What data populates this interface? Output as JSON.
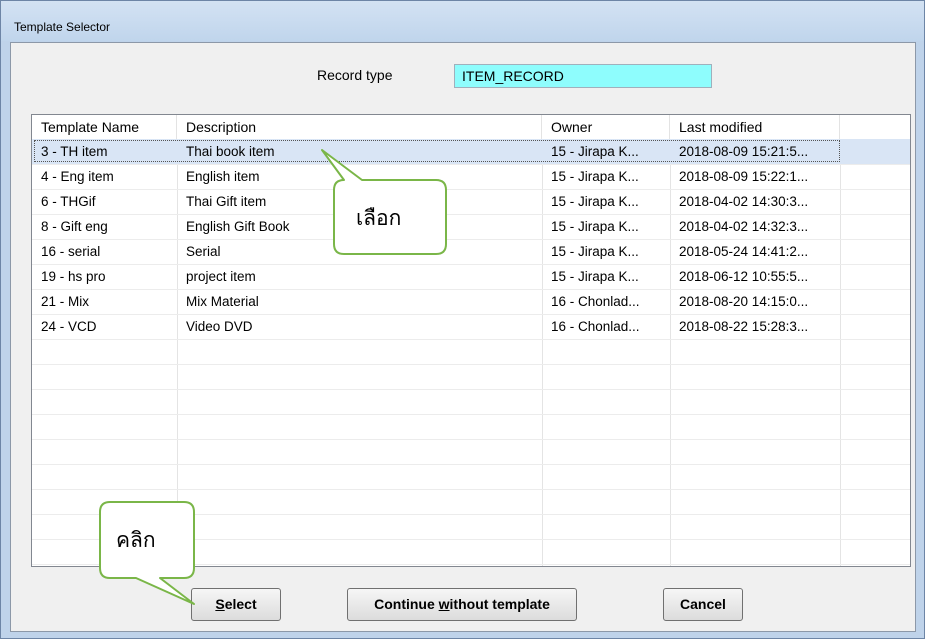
{
  "window": {
    "title": "Template Selector",
    "accent_color": "#bfd3ea"
  },
  "record_type": {
    "label": "Record type",
    "value": "ITEM_RECORD",
    "field_color": "#8efdfd"
  },
  "table": {
    "columns": [
      "Template Name",
      "Description",
      "Owner",
      "Last modified"
    ],
    "rows": [
      {
        "name": "3 - TH item",
        "description": "Thai book item",
        "owner": "15 - Jirapa K...",
        "modified": "2018-08-09 15:21:5...",
        "selected": true
      },
      {
        "name": "4 - Eng item",
        "description": "English item",
        "owner": "15 - Jirapa K...",
        "modified": "2018-08-09 15:22:1..."
      },
      {
        "name": "6 - THGif",
        "description": "Thai Gift item",
        "owner": "15 - Jirapa K...",
        "modified": "2018-04-02 14:30:3..."
      },
      {
        "name": "8 - Gift eng",
        "description": "English Gift Book",
        "owner": "15 - Jirapa K...",
        "modified": "2018-04-02 14:32:3..."
      },
      {
        "name": "16 - serial",
        "description": "Serial",
        "owner": "15 - Jirapa K...",
        "modified": "2018-05-24 14:41:2..."
      },
      {
        "name": "19 - hs pro",
        "description": "project item",
        "owner": "15 - Jirapa K...",
        "modified": "2018-06-12 10:55:5..."
      },
      {
        "name": "21 - Mix",
        "description": "Mix Material",
        "owner": "16 - Chonlad...",
        "modified": "2018-08-20 14:15:0..."
      },
      {
        "name": "24 - VCD",
        "description": "Video DVD",
        "owner": "16 - Chonlad...",
        "modified": "2018-08-22 15:28:3..."
      }
    ]
  },
  "buttons": {
    "select": {
      "pre": "",
      "mnemonic": "S",
      "post": "elect"
    },
    "continue": {
      "pre": "Continue ",
      "mnemonic": "w",
      "post": "ithout template"
    },
    "cancel": {
      "label": "Cancel"
    }
  },
  "annotations": {
    "select_hint": "เลือก",
    "click_hint": "คลิก",
    "callout_color": "#7ab648"
  }
}
